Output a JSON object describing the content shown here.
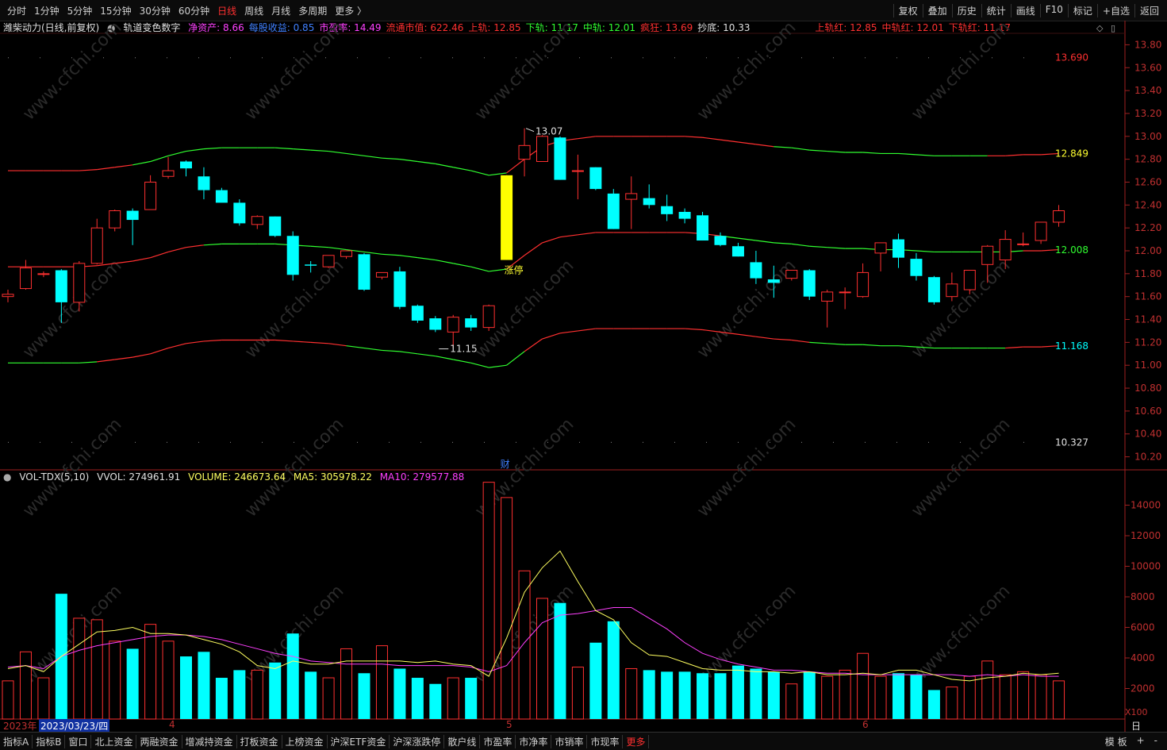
{
  "toolbar": {
    "periods": [
      "分时",
      "1分钟",
      "5分钟",
      "15分钟",
      "30分钟",
      "60分钟",
      "日线",
      "周线",
      "月线",
      "多周期",
      "更多 〉"
    ],
    "active_period": "日线",
    "right_items": [
      "复权",
      "叠加",
      "历史",
      "统计",
      "画线",
      "F10",
      "标记",
      "+自选",
      "返回"
    ]
  },
  "info_row": {
    "stock": "潍柴动力(日线,前复权)",
    "indicator": "轨道变色数字",
    "items": [
      {
        "label": "净资产:",
        "value": "8.66",
        "color": "#ff40ff"
      },
      {
        "label": "每股收益:",
        "value": "0.85",
        "color": "#4080ff"
      },
      {
        "label": "市盈率:",
        "value": "14.49",
        "color": "#ff40ff"
      },
      {
        "label": "流通市值:",
        "value": "622.46",
        "color": "#ff3030"
      },
      {
        "label": "上轨:",
        "value": "12.85",
        "color": "#ff3030"
      },
      {
        "label": "下轨:",
        "value": "11.17",
        "color": "#30ff30"
      },
      {
        "label": "中轨:",
        "value": "12.01",
        "color": "#30ff30"
      },
      {
        "label": "疯狂:",
        "value": "13.69",
        "color": "#ff3030"
      },
      {
        "label": "抄底:",
        "value": "10.33",
        "color": "#e0e0e0"
      }
    ],
    "red_items": [
      {
        "label": "上轨红:",
        "value": "12.85"
      },
      {
        "label": "中轨红:",
        "value": "12.01"
      },
      {
        "label": "下轨红:",
        "value": "11.17"
      }
    ]
  },
  "price_axis": [
    "13.80",
    "13.60",
    "13.40",
    "13.20",
    "13.00",
    "12.80",
    "12.60",
    "12.40",
    "12.20",
    "12.00",
    "11.80",
    "11.60",
    "11.40",
    "11.20",
    "11.00",
    "10.80",
    "10.60",
    "10.40",
    "10.20"
  ],
  "price_labels": {
    "crazy": "13.690",
    "upper": "12.849",
    "mid": "12.008",
    "lower": "11.168",
    "bottom": "10.327",
    "high_mark": "13.07",
    "low_mark": "11.15",
    "limit_up": "涨停",
    "fin": "财"
  },
  "volume_info": {
    "name": "VOL-TDX(5,10)",
    "vvol": "VVOL: 274961.91",
    "volume": "VOLUME: 246673.64",
    "ma5": "MA5: 305978.22",
    "ma10": "MA10: 279577.88"
  },
  "volume_axis": [
    "14000",
    "12000",
    "10000",
    "8000",
    "6000",
    "4000",
    "2000"
  ],
  "volume_unit": "X100",
  "dates": {
    "year": "2023年",
    "cursor": "2023/03/23/四",
    "m4": "4",
    "m5": "5",
    "m6": "6",
    "period": "日线"
  },
  "bottom_tabs": [
    "指标A",
    "指标B",
    "窗口",
    "北上资金",
    "两融资金",
    "增减持资金",
    "打板资金",
    "上榜资金",
    "沪深ETF资金",
    "沪深涨跌停",
    "散户线",
    "市盈率",
    "市净率",
    "市销率",
    "市现率",
    "更多"
  ],
  "bottom_right": [
    "模 板",
    "+",
    "-"
  ],
  "watermark": "www.cfchi.com",
  "colors": {
    "up": "#ff3030",
    "down": "#00ffff",
    "bg": "#000000",
    "upper_band": "#ff3030",
    "green_band": "#30ff30",
    "ma5": "#ffff60",
    "ma10": "#ff40ff",
    "limit": "#ffff00"
  },
  "chart_data": {
    "type": "candlestick",
    "candles": [
      {
        "o": 11.6,
        "h": 11.66,
        "l": 11.55,
        "c": 11.62
      },
      {
        "o": 11.67,
        "h": 11.92,
        "l": 11.66,
        "c": 11.85
      },
      {
        "o": 11.8,
        "h": 11.82,
        "l": 11.77,
        "c": 11.8
      },
      {
        "o": 11.83,
        "h": 11.84,
        "l": 11.37,
        "c": 11.55
      },
      {
        "o": 11.55,
        "h": 11.91,
        "l": 11.47,
        "c": 11.89
      },
      {
        "o": 11.89,
        "h": 12.28,
        "l": 11.88,
        "c": 12.2
      },
      {
        "o": 12.2,
        "h": 12.36,
        "l": 12.17,
        "c": 12.35
      },
      {
        "o": 12.35,
        "h": 12.37,
        "l": 12.05,
        "c": 12.27
      },
      {
        "o": 12.36,
        "h": 12.66,
        "l": 12.36,
        "c": 12.6
      },
      {
        "o": 12.65,
        "h": 12.82,
        "l": 12.63,
        "c": 12.7
      },
      {
        "o": 12.78,
        "h": 12.79,
        "l": 12.65,
        "c": 12.72
      },
      {
        "o": 12.65,
        "h": 12.73,
        "l": 12.45,
        "c": 12.53
      },
      {
        "o": 12.53,
        "h": 12.55,
        "l": 12.44,
        "c": 12.42
      },
      {
        "o": 12.42,
        "h": 12.45,
        "l": 12.22,
        "c": 12.24
      },
      {
        "o": 12.23,
        "h": 12.31,
        "l": 12.19,
        "c": 12.3
      },
      {
        "o": 12.3,
        "h": 12.3,
        "l": 12.12,
        "c": 12.13
      },
      {
        "o": 12.13,
        "h": 12.17,
        "l": 11.74,
        "c": 11.79
      },
      {
        "o": 11.88,
        "h": 11.91,
        "l": 11.81,
        "c": 11.87
      },
      {
        "o": 11.86,
        "h": 11.96,
        "l": 11.85,
        "c": 11.96
      },
      {
        "o": 11.95,
        "h": 12.0,
        "l": 11.93,
        "c": 12.0
      },
      {
        "o": 11.97,
        "h": 11.98,
        "l": 11.65,
        "c": 11.66
      },
      {
        "o": 11.77,
        "h": 11.81,
        "l": 11.75,
        "c": 11.81
      },
      {
        "o": 11.82,
        "h": 11.86,
        "l": 11.49,
        "c": 11.51
      },
      {
        "o": 11.52,
        "h": 11.53,
        "l": 11.37,
        "c": 11.39
      },
      {
        "o": 11.41,
        "h": 11.43,
        "l": 11.29,
        "c": 11.31
      },
      {
        "o": 11.29,
        "h": 11.44,
        "l": 11.15,
        "c": 11.42
      },
      {
        "o": 11.41,
        "h": 11.44,
        "l": 11.3,
        "c": 11.33
      },
      {
        "o": 11.33,
        "h": 11.53,
        "l": 11.3,
        "c": 11.52
      },
      {
        "o": 11.92,
        "h": 12.66,
        "l": 11.92,
        "c": 12.66
      },
      {
        "o": 12.8,
        "h": 13.07,
        "l": 12.65,
        "c": 12.92
      },
      {
        "o": 12.78,
        "h": 13.01,
        "l": 12.78,
        "c": 13.0
      },
      {
        "o": 12.99,
        "h": 13.0,
        "l": 12.62,
        "c": 12.62
      },
      {
        "o": 12.7,
        "h": 12.84,
        "l": 12.45,
        "c": 12.7
      },
      {
        "o": 12.73,
        "h": 12.73,
        "l": 12.53,
        "c": 12.54
      },
      {
        "o": 12.5,
        "h": 12.54,
        "l": 12.19,
        "c": 12.19
      },
      {
        "o": 12.45,
        "h": 12.65,
        "l": 12.19,
        "c": 12.5
      },
      {
        "o": 12.46,
        "h": 12.58,
        "l": 12.37,
        "c": 12.4
      },
      {
        "o": 12.39,
        "h": 12.49,
        "l": 12.26,
        "c": 12.32
      },
      {
        "o": 12.34,
        "h": 12.37,
        "l": 12.24,
        "c": 12.28
      },
      {
        "o": 12.31,
        "h": 12.34,
        "l": 12.09,
        "c": 12.09
      },
      {
        "o": 12.13,
        "h": 12.16,
        "l": 12.04,
        "c": 12.05
      },
      {
        "o": 12.04,
        "h": 12.07,
        "l": 11.95,
        "c": 11.95
      },
      {
        "o": 11.9,
        "h": 12.0,
        "l": 11.71,
        "c": 11.76
      },
      {
        "o": 11.75,
        "h": 11.87,
        "l": 11.59,
        "c": 11.72
      },
      {
        "o": 11.76,
        "h": 11.83,
        "l": 11.74,
        "c": 11.83
      },
      {
        "o": 11.83,
        "h": 11.84,
        "l": 11.57,
        "c": 11.6
      },
      {
        "o": 11.56,
        "h": 11.66,
        "l": 11.33,
        "c": 11.64
      },
      {
        "o": 11.64,
        "h": 11.68,
        "l": 11.49,
        "c": 11.64
      },
      {
        "o": 11.6,
        "h": 11.89,
        "l": 11.59,
        "c": 11.81
      },
      {
        "o": 11.98,
        "h": 12.0,
        "l": 11.82,
        "c": 12.07
      },
      {
        "o": 12.1,
        "h": 12.15,
        "l": 11.85,
        "c": 11.94
      },
      {
        "o": 11.93,
        "h": 11.98,
        "l": 11.74,
        "c": 11.78
      },
      {
        "o": 11.77,
        "h": 11.78,
        "l": 11.53,
        "c": 11.55
      },
      {
        "o": 11.6,
        "h": 11.81,
        "l": 11.56,
        "c": 11.71
      },
      {
        "o": 11.66,
        "h": 11.83,
        "l": 11.62,
        "c": 11.83
      },
      {
        "o": 11.88,
        "h": 12.05,
        "l": 11.72,
        "c": 12.04
      },
      {
        "o": 11.92,
        "h": 12.18,
        "l": 11.84,
        "c": 12.1
      },
      {
        "o": 12.06,
        "h": 12.16,
        "l": 12.04,
        "c": 12.06
      },
      {
        "o": 12.09,
        "h": 12.19,
        "l": 12.06,
        "c": 12.25
      },
      {
        "o": 12.25,
        "h": 12.4,
        "l": 12.21,
        "c": 12.35
      }
    ],
    "volume": [
      2500,
      4400,
      2700,
      8200,
      6600,
      6500,
      5100,
      4600,
      6200,
      5100,
      4100,
      4400,
      2700,
      3200,
      3200,
      3700,
      5600,
      3100,
      2700,
      4600,
      3000,
      4800,
      3300,
      2700,
      2300,
      2700,
      2700,
      15500,
      14500,
      9700,
      7900,
      7600,
      3400,
      5000,
      6400,
      3300,
      3200,
      3100,
      3100,
      3000,
      3000,
      3500,
      3300,
      3100,
      2300,
      3100,
      2800,
      3200,
      4300,
      2800,
      3000,
      2900,
      1900,
      2100,
      2800,
      3800,
      2900,
      3100,
      2900,
      2500
    ],
    "ma5": [
      3300,
      3500,
      3100,
      4100,
      4900,
      5700,
      5800,
      6000,
      5600,
      5600,
      5500,
      5200,
      4900,
      4400,
      3500,
      3300,
      3800,
      3600,
      3600,
      3800,
      3800,
      3800,
      3800,
      3700,
      3800,
      3600,
      3500,
      2800,
      5300,
      8300,
      9900,
      11000,
      9000,
      7100,
      6500,
      5000,
      4200,
      4100,
      3700,
      3300,
      3200,
      3200,
      3100,
      3100,
      3000,
      3100,
      2900,
      2900,
      3000,
      2900,
      3200,
      3200,
      2900,
      2600,
      2500,
      2700,
      2800,
      3000,
      2900,
      3000
    ],
    "ma10": [
      3400,
      3500,
      3300,
      4100,
      4500,
      4800,
      5000,
      5200,
      5400,
      5500,
      5500,
      5400,
      5200,
      4900,
      4600,
      4300,
      4100,
      3800,
      3700,
      3600,
      3600,
      3600,
      3500,
      3500,
      3500,
      3500,
      3400,
      3100,
      3500,
      5000,
      6300,
      6800,
      6900,
      7100,
      7300,
      7300,
      6600,
      5900,
      5000,
      4300,
      3900,
      3600,
      3400,
      3200,
      3200,
      3100,
      3000,
      3000,
      2900,
      2900,
      2900,
      2900,
      2900,
      2900,
      2800,
      2900,
      2800,
      2900,
      2800,
      2800
    ],
    "bands": {
      "upper": [
        12.7,
        12.7,
        12.7,
        12.7,
        12.7,
        12.71,
        12.73,
        12.75,
        12.78,
        12.83,
        12.87,
        12.89,
        12.9,
        12.9,
        12.9,
        12.9,
        12.89,
        12.88,
        12.87,
        12.85,
        12.83,
        12.81,
        12.8,
        12.78,
        12.76,
        12.73,
        12.7,
        12.66,
        12.68,
        12.8,
        12.91,
        12.96,
        12.98,
        13.0,
        13.0,
        13.0,
        13.0,
        13.0,
        13.0,
        12.99,
        12.97,
        12.95,
        12.93,
        12.91,
        12.9,
        12.88,
        12.87,
        12.86,
        12.86,
        12.85,
        12.85,
        12.84,
        12.83,
        12.83,
        12.83,
        12.83,
        12.83,
        12.84,
        12.84,
        12.85
      ],
      "mid": [
        11.86,
        11.86,
        11.86,
        11.86,
        11.86,
        11.87,
        11.89,
        11.91,
        11.94,
        11.99,
        12.03,
        12.05,
        12.06,
        12.06,
        12.06,
        12.06,
        12.05,
        12.04,
        12.03,
        12.01,
        11.99,
        11.97,
        11.96,
        11.94,
        11.92,
        11.89,
        11.86,
        11.82,
        11.84,
        11.96,
        12.07,
        12.12,
        12.14,
        12.16,
        12.16,
        12.16,
        12.16,
        12.16,
        12.16,
        12.15,
        12.13,
        12.11,
        12.09,
        12.07,
        12.06,
        12.04,
        12.03,
        12.02,
        12.02,
        12.01,
        12.01,
        12.0,
        11.99,
        11.99,
        11.99,
        11.99,
        11.99,
        12.0,
        12.0,
        12.01
      ],
      "lower": [
        11.02,
        11.02,
        11.02,
        11.02,
        11.02,
        11.03,
        11.05,
        11.07,
        11.1,
        11.15,
        11.19,
        11.21,
        11.22,
        11.22,
        11.22,
        11.22,
        11.21,
        11.2,
        11.19,
        11.17,
        11.15,
        11.13,
        11.12,
        11.1,
        11.08,
        11.05,
        11.02,
        10.98,
        11.0,
        11.12,
        11.23,
        11.28,
        11.3,
        11.32,
        11.32,
        11.32,
        11.32,
        11.32,
        11.32,
        11.31,
        11.29,
        11.27,
        11.25,
        11.23,
        11.22,
        11.2,
        11.19,
        11.18,
        11.18,
        11.17,
        11.17,
        11.16,
        11.15,
        11.15,
        11.15,
        11.15,
        11.15,
        11.16,
        11.16,
        11.17
      ]
    },
    "price_range": [
      10.1,
      13.9
    ],
    "volume_range": [
      0,
      16000
    ]
  }
}
